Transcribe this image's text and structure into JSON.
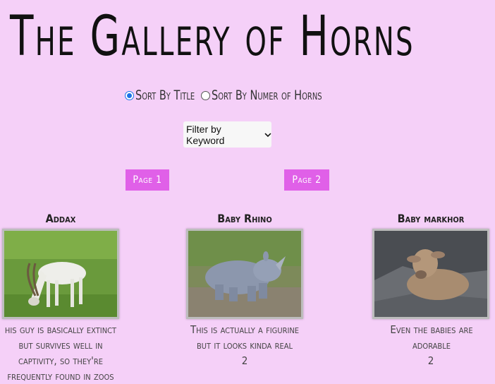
{
  "header": {
    "title": "The Gallery of Horns"
  },
  "sort": {
    "options": [
      {
        "label": "Sort By Title",
        "checked": true
      },
      {
        "label": "Sort By Numer of Horns",
        "checked": false
      }
    ]
  },
  "filter": {
    "selected": "Filter by Keyword"
  },
  "pagination": {
    "page1": "Page 1",
    "page2": "Page 2"
  },
  "gallery": [
    {
      "title": "Addax",
      "description": "his guy is basically extinct but survives well in captivity, so they're frequently found in zoos",
      "horns": ""
    },
    {
      "title": "Baby Rhino",
      "description": "This is actually a figurine but it looks kinda real",
      "horns": "2"
    },
    {
      "title": "Baby markhor",
      "description": "Even the babies are adorable",
      "horns": "2"
    }
  ]
}
